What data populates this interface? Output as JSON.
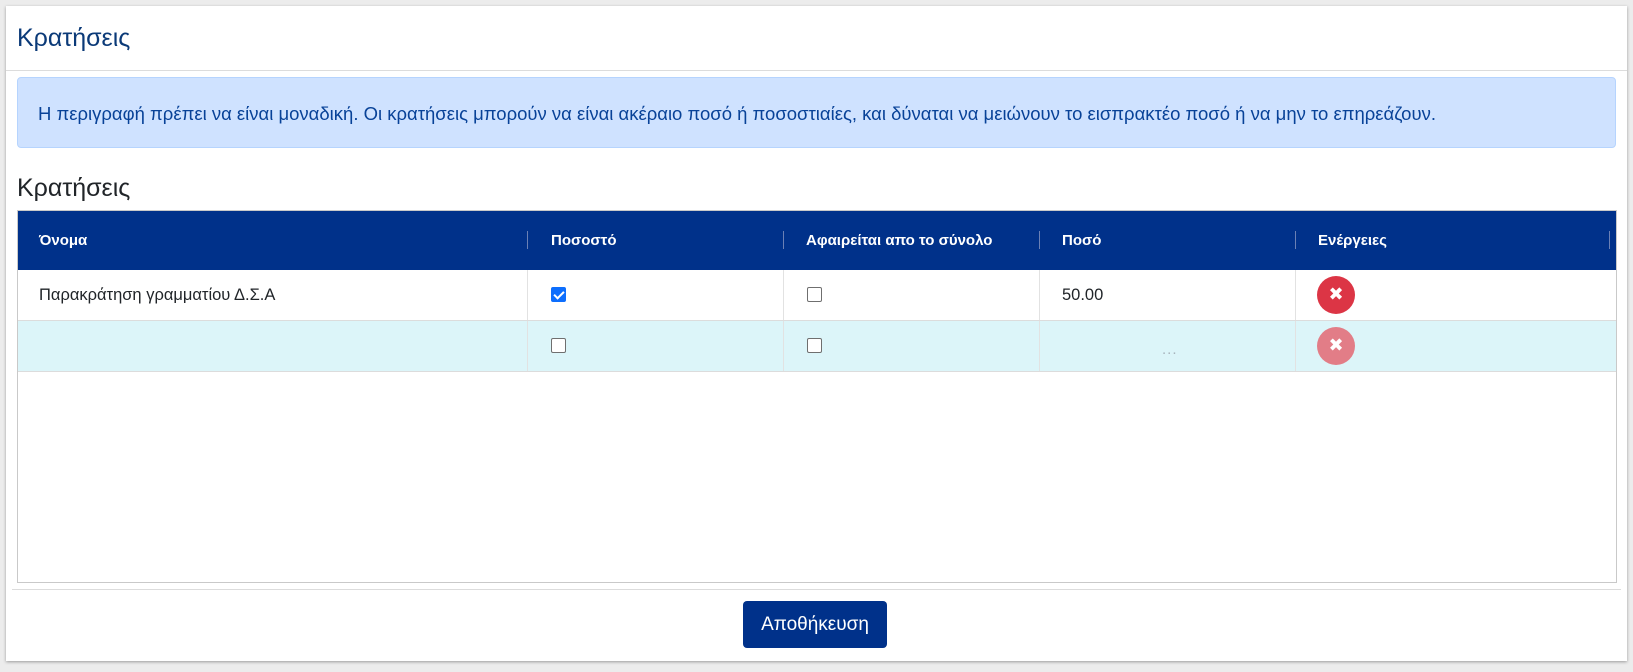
{
  "page": {
    "title": "Κρατήσεις"
  },
  "alert": {
    "text": "Η περιγραφή πρέπει να είναι μοναδική. Οι κρατήσεις μπορούν να είναι ακέραιο ποσό ή ποσοστιαίες, και δύναται να μειώνουν το εισπρακτέο ποσό ή να μην το επηρεάζουν."
  },
  "section": {
    "title": "Κρατήσεις"
  },
  "table": {
    "columns": [
      "Όνομα",
      "Ποσοστό",
      "Αφαιρείται απο το σύνολο",
      "Ποσό",
      "Ενέργειες"
    ],
    "rows": [
      {
        "name": "Παρακράτηση γραμματίου Δ.Σ.Α",
        "percentage": true,
        "deducted": false,
        "amount": "50.00"
      },
      {
        "name": "",
        "percentage": false,
        "deducted": false,
        "amount": "..."
      }
    ],
    "delete_glyph": "✖"
  },
  "footer": {
    "save_label": "Αποθήκευση"
  },
  "colors": {
    "header_bg": "#00318a",
    "accent": "#0b3a78",
    "alert_bg": "#cfe2ff",
    "alert_text": "#084298",
    "danger": "#dc3545",
    "new_row_bg": "#dcf5f9"
  },
  "icons": {
    "delete": "close-x-icon"
  }
}
